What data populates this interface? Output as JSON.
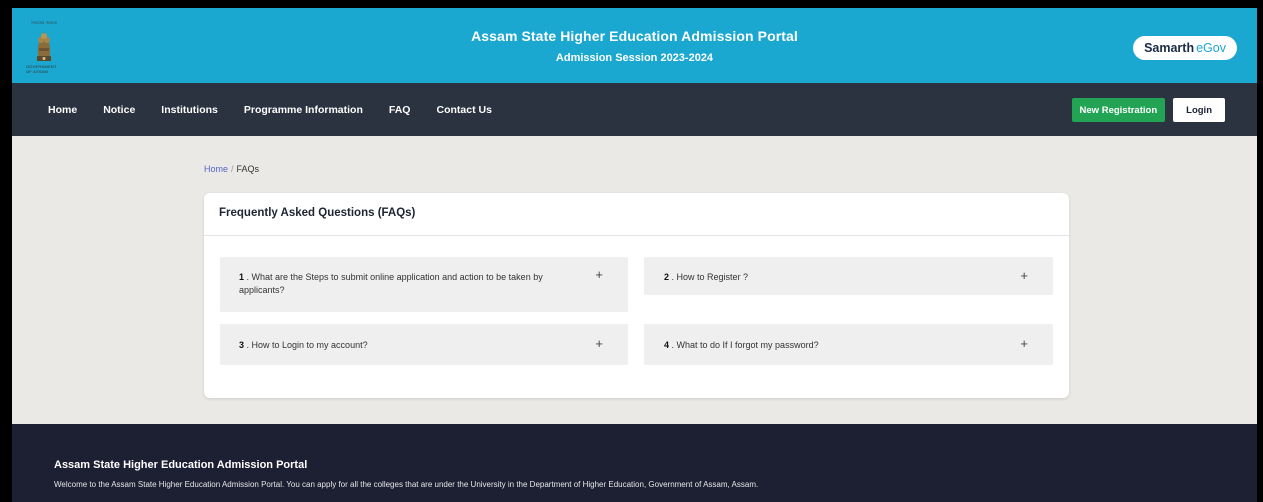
{
  "header": {
    "title": "Assam State Higher Education Admission Portal",
    "subtitle": "Admission Session 2023-2024",
    "emblem_top_text": "সত্যমেব জয়তে",
    "emblem_bottom_text": "GOVERNMENT OF ASSAM",
    "brand_part1": "Samarth",
    "brand_part2": "eGov"
  },
  "nav": {
    "items": [
      "Home",
      "Notice",
      "Institutions",
      "Programme Information",
      "FAQ",
      "Contact Us"
    ],
    "new_registration": "New Registration",
    "login": "Login"
  },
  "breadcrumb": {
    "home": "Home",
    "separator": "/",
    "current": "FAQs"
  },
  "faq": {
    "heading": "Frequently Asked Questions (FAQs)",
    "items": [
      {
        "num": "1",
        "text": " . What are the Steps to submit online application and action to be taken by applicants?"
      },
      {
        "num": "2",
        "text": " . How to Register ?"
      },
      {
        "num": "3",
        "text": " . How to Login to my account?"
      },
      {
        "num": "4",
        "text": " . What to do If I forgot my password?"
      }
    ],
    "expand_symbol": "+"
  },
  "footer": {
    "title": "Assam State Higher Education Admission Portal",
    "description": "Welcome to the Assam State Higher Education Admission Portal. You can apply for all the colleges that are under the University in the Department of Higher Education, Government of Assam, Assam."
  },
  "colors": {
    "header_bg": "#1aa7d0",
    "nav_bg": "#2b3240",
    "green_button": "#23a455",
    "footer_bg": "#1d1f33"
  }
}
